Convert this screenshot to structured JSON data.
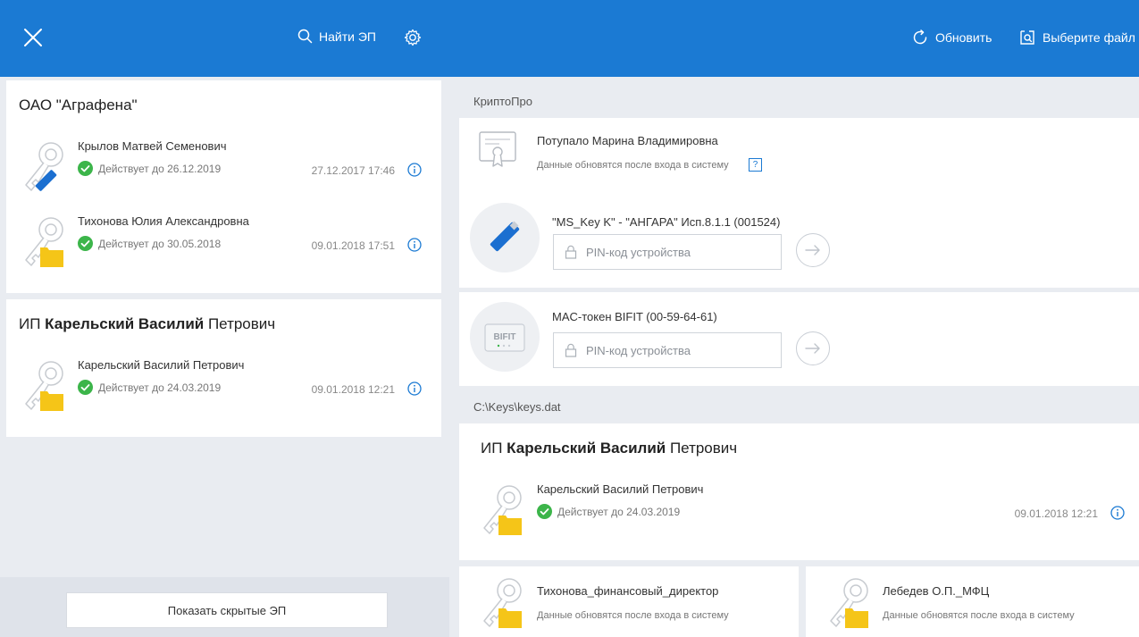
{
  "header": {
    "find_label": "Найти ЭП",
    "refresh_label": "Обновить",
    "choose_file_label": "Выберите файл"
  },
  "left": {
    "orgs": [
      {
        "title": "ОАО \"Аграфена\"",
        "certs": [
          {
            "name": "Крылов Матвей Семенович",
            "status": "Действует до 26.12.2019",
            "date": "27.12.2017 17:46",
            "media": "token"
          },
          {
            "name": "Тихонова Юлия Александровна",
            "status": "Действует до 30.05.2018",
            "date": "09.01.2018 17:51",
            "media": "folder"
          }
        ]
      },
      {
        "title_prefix": "ИП ",
        "title_bold": "Карельский Василий",
        "title_suffix": " Петрович",
        "certs": [
          {
            "name": "Карельский Василий Петрович",
            "status": "Действует до 24.03.2019",
            "date": "09.01.2018 12:21",
            "media": "folder"
          }
        ]
      }
    ],
    "show_hidden_label": "Показать скрытые ЭП"
  },
  "right": {
    "sections": [
      {
        "label": "КриптоПро"
      },
      {
        "label": "C:\\Keys\\keys.dat"
      }
    ],
    "cryptopro_cert": {
      "name": "Потупало Марина Владимировна",
      "note": "Данные обновятся после входа в систему",
      "help": "?"
    },
    "devices": [
      {
        "name": "\"MS_Key K\" - \"АНГАРА\" Исп.8.1.1 (001524)",
        "pin_placeholder": "PIN-код устройства"
      },
      {
        "name": "MAC-токен BIFIT (00-59-64-61)",
        "pin_placeholder": "PIN-код устройства",
        "device_brand": "BIFIT"
      }
    ],
    "file_org": {
      "title_prefix": "ИП ",
      "title_bold": "Карельский Василий",
      "title_suffix": " Петрович",
      "cert_name": "Карельский Василий Петрович",
      "status": "Действует до 24.03.2019",
      "date": "09.01.2018 12:21"
    },
    "bottom_certs": [
      {
        "name": "Тихонова_финансовый_директор",
        "note": "Данные обновятся после входа в систему"
      },
      {
        "name": "Лебедев О.П._МФЦ",
        "note": "Данные обновятся после входа в систему"
      }
    ]
  },
  "colors": {
    "header": "#1b7ad3",
    "valid": "#3cb54a",
    "folder": "#f5c518",
    "token": "#1b6fd0",
    "bg": "#e9ecf1"
  }
}
